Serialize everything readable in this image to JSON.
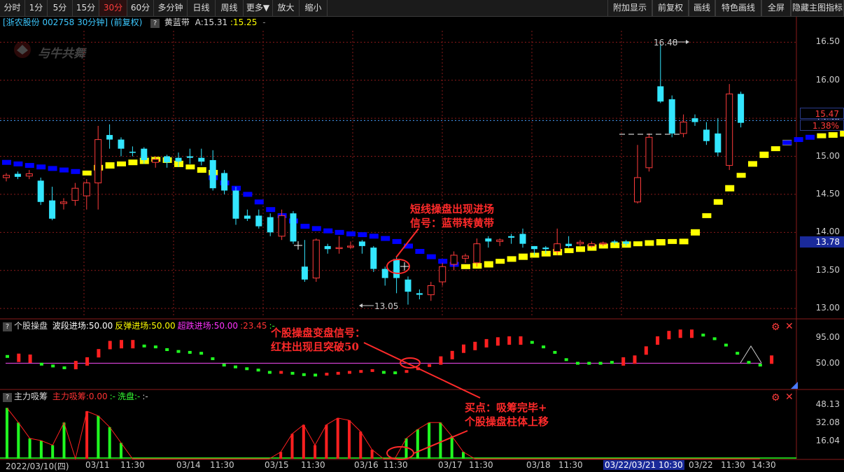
{
  "toolbar": {
    "periods": [
      "分时",
      "1分",
      "5分",
      "15分",
      "30分",
      "60分",
      "多分钟",
      "日线",
      "周线",
      "更多▼",
      "放大",
      "缩小"
    ],
    "active_period": "30分",
    "right_buttons": [
      "附加显示",
      "前复权",
      "画线",
      "特色画线",
      "全屏",
      "隐藏主图指标"
    ]
  },
  "info": {
    "stock": "[浙农股份 002758 30分钟] (前复权)",
    "indicator": "黄蓝带",
    "a_label": "A:15.31",
    "a_value2": ":15.25"
  },
  "watermark": "与牛共舞",
  "main_chart": {
    "y_ticks": [
      "16.50",
      "16.00",
      "15.50",
      "15.00",
      "14.50",
      "14.00",
      "13.50",
      "13.00"
    ],
    "current_price": "15.47",
    "change_pct": "1.38%",
    "marker_price": "13.78",
    "high_label": "16.48",
    "low_label": "13.05"
  },
  "sub1": {
    "name": "个股操盘",
    "params": [
      {
        "text": "波段进场:50.00",
        "color": "#ffffff"
      },
      {
        "text": "反弹进场:50.00",
        "color": "#ffff00"
      },
      {
        "text": "超跌进场:50.00",
        "color": "#ff33ff"
      },
      {
        "text": ":23.45",
        "color": "#ff3333"
      },
      {
        "text": ":-",
        "color": "#33ff33"
      }
    ],
    "y_ticks": [
      "95.00",
      "50.00"
    ]
  },
  "sub2": {
    "name": "主力吸筹",
    "params": [
      {
        "text": "主力吸筹:0.00",
        "color": "#ff3333"
      },
      {
        "text": ":-",
        "color": "#33ff33"
      },
      {
        "text": "洗盘:-",
        "color": "#33ff33"
      },
      {
        "text": ":-",
        "color": "#cccccc"
      }
    ],
    "y_ticks": [
      "48.13",
      "32.08",
      "16.04"
    ]
  },
  "time_axis": [
    "2022/03/10(四)",
    "03/11",
    "11:30",
    "03/14",
    "11:30",
    "03/15",
    "11:30",
    "03/16",
    "11:30",
    "03/17",
    "11:30",
    "03/18",
    "11:30",
    "03/22/03/21 10:30",
    "03/22",
    "11:30",
    "14:30"
  ],
  "annotations": {
    "a1_line1": "短线操盘出现进场",
    "a1_line2": "信号：蓝带转黄带",
    "a2_line1": "个股操盘变盘信号：",
    "a2_line2": "红柱出现且突破50",
    "a3_line1": "买点：吸筹完毕+",
    "a3_line2": "个股操盘柱体上移"
  },
  "colors": {
    "up": "#ff3b3b",
    "down": "#33e6ff",
    "yellow_band": "#ffff00",
    "blue_band": "#0000ff",
    "sub_up": "#ff2020",
    "sub_down": "#20ff20",
    "grid": "#8a1a1a",
    "annotation": "#ff2a2a"
  },
  "chart_data": {
    "type": "candlestick",
    "candles": [
      [
        14.72,
        14.75,
        14.67,
        14.78
      ],
      [
        14.77,
        14.73,
        14.7,
        14.8
      ],
      [
        14.74,
        14.77,
        14.7,
        14.82
      ],
      [
        14.68,
        14.4,
        14.36,
        14.72
      ],
      [
        14.42,
        14.18,
        14.16,
        14.6
      ],
      [
        14.38,
        14.4,
        14.3,
        14.45
      ],
      [
        14.42,
        14.58,
        14.35,
        14.65
      ],
      [
        14.48,
        14.65,
        14.3,
        14.7
      ],
      [
        14.65,
        15.22,
        14.3,
        15.4
      ],
      [
        15.28,
        15.22,
        15.1,
        15.42
      ],
      [
        15.22,
        15.1,
        15.0,
        15.25
      ],
      [
        15.06,
        15.05,
        15.0,
        15.13
      ],
      [
        15.1,
        14.95,
        14.9,
        15.12
      ],
      [
        14.92,
        14.96,
        14.85,
        15.0
      ],
      [
        15.0,
        14.92,
        14.85,
        15.02
      ],
      [
        14.98,
        14.93,
        14.86,
        15.05
      ],
      [
        15.0,
        14.98,
        14.9,
        15.1
      ],
      [
        14.98,
        14.93,
        14.88,
        15.1
      ],
      [
        14.95,
        14.58,
        14.55,
        15.08
      ],
      [
        14.78,
        14.55,
        14.5,
        14.82
      ],
      [
        14.55,
        14.18,
        14.1,
        14.6
      ],
      [
        14.22,
        14.18,
        14.15,
        14.3
      ],
      [
        14.22,
        14.08,
        14.05,
        14.3
      ],
      [
        14.2,
        14.0,
        13.95,
        14.25
      ],
      [
        13.95,
        14.22,
        13.9,
        14.3
      ],
      [
        14.25,
        13.88,
        13.85,
        14.28
      ],
      [
        13.55,
        13.38,
        13.35,
        13.9
      ],
      [
        13.4,
        13.9,
        13.35,
        13.92
      ],
      [
        13.82,
        13.78,
        13.72,
        13.85
      ],
      [
        13.8,
        13.8,
        13.72,
        13.95
      ],
      [
        13.82,
        13.82,
        13.78,
        13.88
      ],
      [
        13.88,
        13.82,
        13.72,
        13.9
      ],
      [
        13.8,
        13.52,
        13.48,
        13.82
      ],
      [
        13.52,
        13.4,
        13.3,
        13.55
      ],
      [
        13.65,
        13.4,
        13.2,
        13.68
      ],
      [
        13.38,
        13.22,
        13.05,
        13.42
      ],
      [
        13.2,
        13.18,
        13.12,
        13.25
      ],
      [
        13.18,
        13.3,
        13.1,
        13.35
      ],
      [
        13.35,
        13.55,
        13.3,
        13.6
      ],
      [
        13.58,
        13.7,
        13.5,
        13.75
      ],
      [
        13.66,
        13.69,
        13.6,
        13.72
      ],
      [
        13.6,
        13.85,
        13.55,
        13.92
      ],
      [
        13.92,
        13.88,
        13.8,
        13.95
      ],
      [
        13.88,
        13.9,
        13.82,
        13.92
      ],
      [
        13.95,
        13.93,
        13.85,
        13.98
      ],
      [
        13.98,
        13.85,
        13.8,
        14.05
      ],
      [
        13.82,
        13.78,
        13.7,
        13.82
      ],
      [
        13.8,
        13.78,
        13.72,
        13.82
      ],
      [
        13.75,
        13.85,
        13.7,
        14.05
      ],
      [
        13.85,
        13.82,
        13.8,
        13.95
      ],
      [
        13.85,
        13.87,
        13.82,
        13.9
      ],
      [
        13.82,
        13.85,
        13.8,
        13.88
      ],
      [
        13.85,
        13.86,
        13.82,
        13.88
      ],
      [
        13.88,
        13.87,
        13.84,
        13.9
      ],
      [
        13.88,
        13.85,
        13.82,
        13.9
      ],
      [
        14.4,
        14.72,
        14.38,
        15.15
      ],
      [
        14.85,
        15.25,
        14.8,
        15.3
      ],
      [
        15.92,
        15.72,
        15.7,
        16.48
      ],
      [
        15.75,
        15.3,
        15.25,
        15.8
      ],
      [
        15.3,
        15.45,
        15.25,
        15.55
      ],
      [
        15.5,
        15.45,
        15.4,
        15.55
      ],
      [
        15.35,
        15.2,
        15.15,
        15.45
      ],
      [
        15.3,
        15.05,
        15.0,
        15.5
      ],
      [
        14.88,
        15.82,
        14.82,
        15.95
      ],
      [
        15.82,
        15.44,
        15.38,
        15.85
      ]
    ],
    "bands": [
      {
        "color": "blue",
        "values": [
          14.92,
          14.9,
          14.88,
          14.86,
          14.84,
          14.82,
          14.8,
          14.78
        ]
      },
      {
        "color": "yellow",
        "values": [
          14.78,
          14.85,
          14.88,
          14.9,
          14.92,
          14.94,
          14.96,
          14.95,
          14.9,
          14.86,
          14.82,
          14.78
        ]
      },
      {
        "color": "blue",
        "values": [
          14.72,
          14.65,
          14.58,
          14.5,
          14.4,
          14.3,
          14.22,
          14.15,
          14.08,
          14.05,
          14.02,
          14.0,
          13.98,
          13.97,
          13.95,
          13.92,
          13.88,
          13.82,
          13.75,
          13.68,
          13.62,
          13.58,
          13.55
        ]
      },
      {
        "color": "yellow",
        "values": [
          13.55,
          13.56,
          13.58,
          13.62,
          13.65,
          13.68,
          13.7,
          13.72,
          13.74,
          13.76,
          13.78,
          13.8,
          13.82,
          13.83,
          13.84,
          13.85,
          13.86,
          13.87,
          13.88,
          13.88,
          14.0,
          14.22,
          14.4,
          14.58,
          14.75,
          14.9,
          15.02,
          15.1,
          15.18
        ]
      },
      {
        "color": "blue",
        "values": [
          15.18,
          15.22,
          15.25,
          15.27
        ]
      },
      {
        "color": "yellow",
        "values": [
          15.27,
          15.28,
          15.3
        ]
      }
    ],
    "sub1_bars": [
      [
        "g",
        65
      ],
      [
        "r",
        62
      ],
      [
        "r",
        60
      ],
      [
        "g",
        48
      ],
      [
        "g",
        44
      ],
      [
        "g",
        40
      ],
      [
        "r",
        46
      ],
      [
        "r",
        54
      ],
      [
        "r",
        72
      ],
      [
        "r",
        90
      ],
      [
        "r",
        92
      ],
      [
        "r",
        92
      ],
      [
        "g",
        88
      ],
      [
        "g",
        86
      ],
      [
        "g",
        80
      ],
      [
        "g",
        76
      ],
      [
        "g",
        74
      ],
      [
        "g",
        72
      ],
      [
        "g",
        60
      ],
      [
        "g",
        46
      ],
      [
        "g",
        42
      ],
      [
        "g",
        38
      ],
      [
        "g",
        35
      ],
      [
        "g",
        30
      ],
      [
        "r",
        30
      ],
      [
        "g",
        28
      ],
      [
        "g",
        25
      ],
      [
        "g",
        24
      ],
      [
        "r",
        26
      ],
      [
        "r",
        28
      ],
      [
        "r",
        30
      ],
      [
        "r",
        32
      ],
      [
        "r",
        34
      ],
      [
        "g",
        30
      ],
      [
        "g",
        29
      ],
      [
        "r",
        32
      ],
      [
        "r",
        38
      ],
      [
        "r",
        45
      ],
      [
        "r",
        56
      ],
      [
        "r",
        68
      ],
      [
        "r",
        82
      ],
      [
        "r",
        88
      ],
      [
        "r",
        94
      ],
      [
        "r",
        98
      ],
      [
        "r",
        100
      ],
      [
        "r",
        100
      ],
      [
        "g",
        96
      ],
      [
        "g",
        86
      ],
      [
        "g",
        74
      ],
      [
        "g",
        58
      ],
      [
        "g",
        50
      ],
      [
        "g",
        50
      ],
      [
        "g",
        50
      ],
      [
        "g",
        52
      ],
      [
        "r",
        54
      ],
      [
        "r",
        58
      ],
      [
        "r",
        78
      ],
      [
        "r",
        100
      ],
      [
        "r",
        112
      ],
      [
        "r",
        115
      ],
      [
        "r",
        115
      ],
      [
        "g",
        112
      ],
      [
        "g",
        104
      ],
      [
        "g",
        90
      ],
      [
        "g",
        72
      ],
      [
        "g",
        52
      ],
      [
        "g",
        46
      ],
      [
        "r",
        58
      ]
    ],
    "sub2_bars": [
      45,
      32,
      18,
      16,
      12,
      32,
      0,
      42,
      38,
      28,
      14,
      0,
      0,
      0,
      0,
      0,
      0,
      0,
      0,
      0,
      0,
      0,
      0,
      0,
      6,
      22,
      30,
      12,
      30,
      36,
      34,
      24,
      8,
      0,
      0,
      18,
      26,
      32,
      32,
      20,
      6,
      0,
      0,
      0,
      0,
      0,
      0,
      0,
      0,
      0,
      0,
      0,
      0,
      0,
      0,
      0,
      0,
      0,
      0,
      0,
      0,
      0,
      0,
      0,
      0,
      0,
      0
    ],
    "x_range": [
      0,
      66
    ],
    "y_range": [
      12.9,
      16.65
    ]
  }
}
